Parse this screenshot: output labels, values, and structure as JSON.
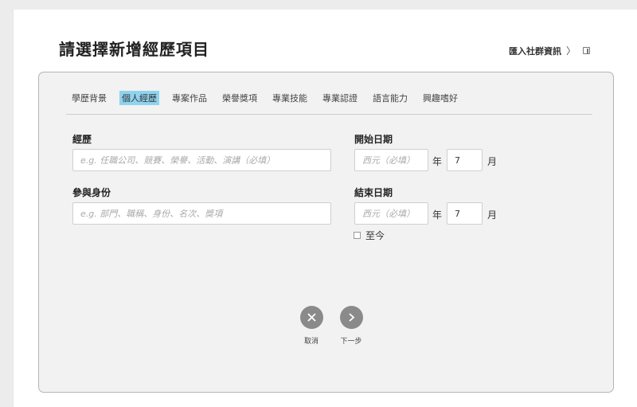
{
  "page": {
    "title": "請選擇新增經歷項目",
    "import_label": "匯入社群資訊",
    "import_chevron": "〉"
  },
  "tabs": [
    {
      "label": "學歷背景",
      "active": false
    },
    {
      "label": "個人經歷",
      "active": true
    },
    {
      "label": "專案作品",
      "active": false
    },
    {
      "label": "榮譽獎項",
      "active": false
    },
    {
      "label": "專業技能",
      "active": false
    },
    {
      "label": "專業認證",
      "active": false
    },
    {
      "label": "語言能力",
      "active": false
    },
    {
      "label": "興趣嗜好",
      "active": false
    }
  ],
  "form": {
    "experience": {
      "label": "經歷",
      "placeholder": "e.g. 任職公司、競賽、榮譽、活動、演講（必填）",
      "value": ""
    },
    "role": {
      "label": "參與身份",
      "placeholder": "e.g. 部門、職稱、身份、名次、獎項",
      "value": ""
    },
    "start_date": {
      "label": "開始日期",
      "year_placeholder": "西元（必填）",
      "year_unit": "年",
      "month_value": "7",
      "month_unit": "月"
    },
    "end_date": {
      "label": "結束日期",
      "year_placeholder": "西元（必填）",
      "year_unit": "年",
      "month_value": "7",
      "month_unit": "月"
    },
    "until_now": {
      "label": "至今",
      "checked": false
    }
  },
  "actions": {
    "cancel_label": "取消",
    "next_label": "下一步"
  },
  "colors": {
    "active_tab": "#8fd3ef",
    "action_button": "#8a8a8a",
    "panel_bg": "#f2f2f2"
  }
}
